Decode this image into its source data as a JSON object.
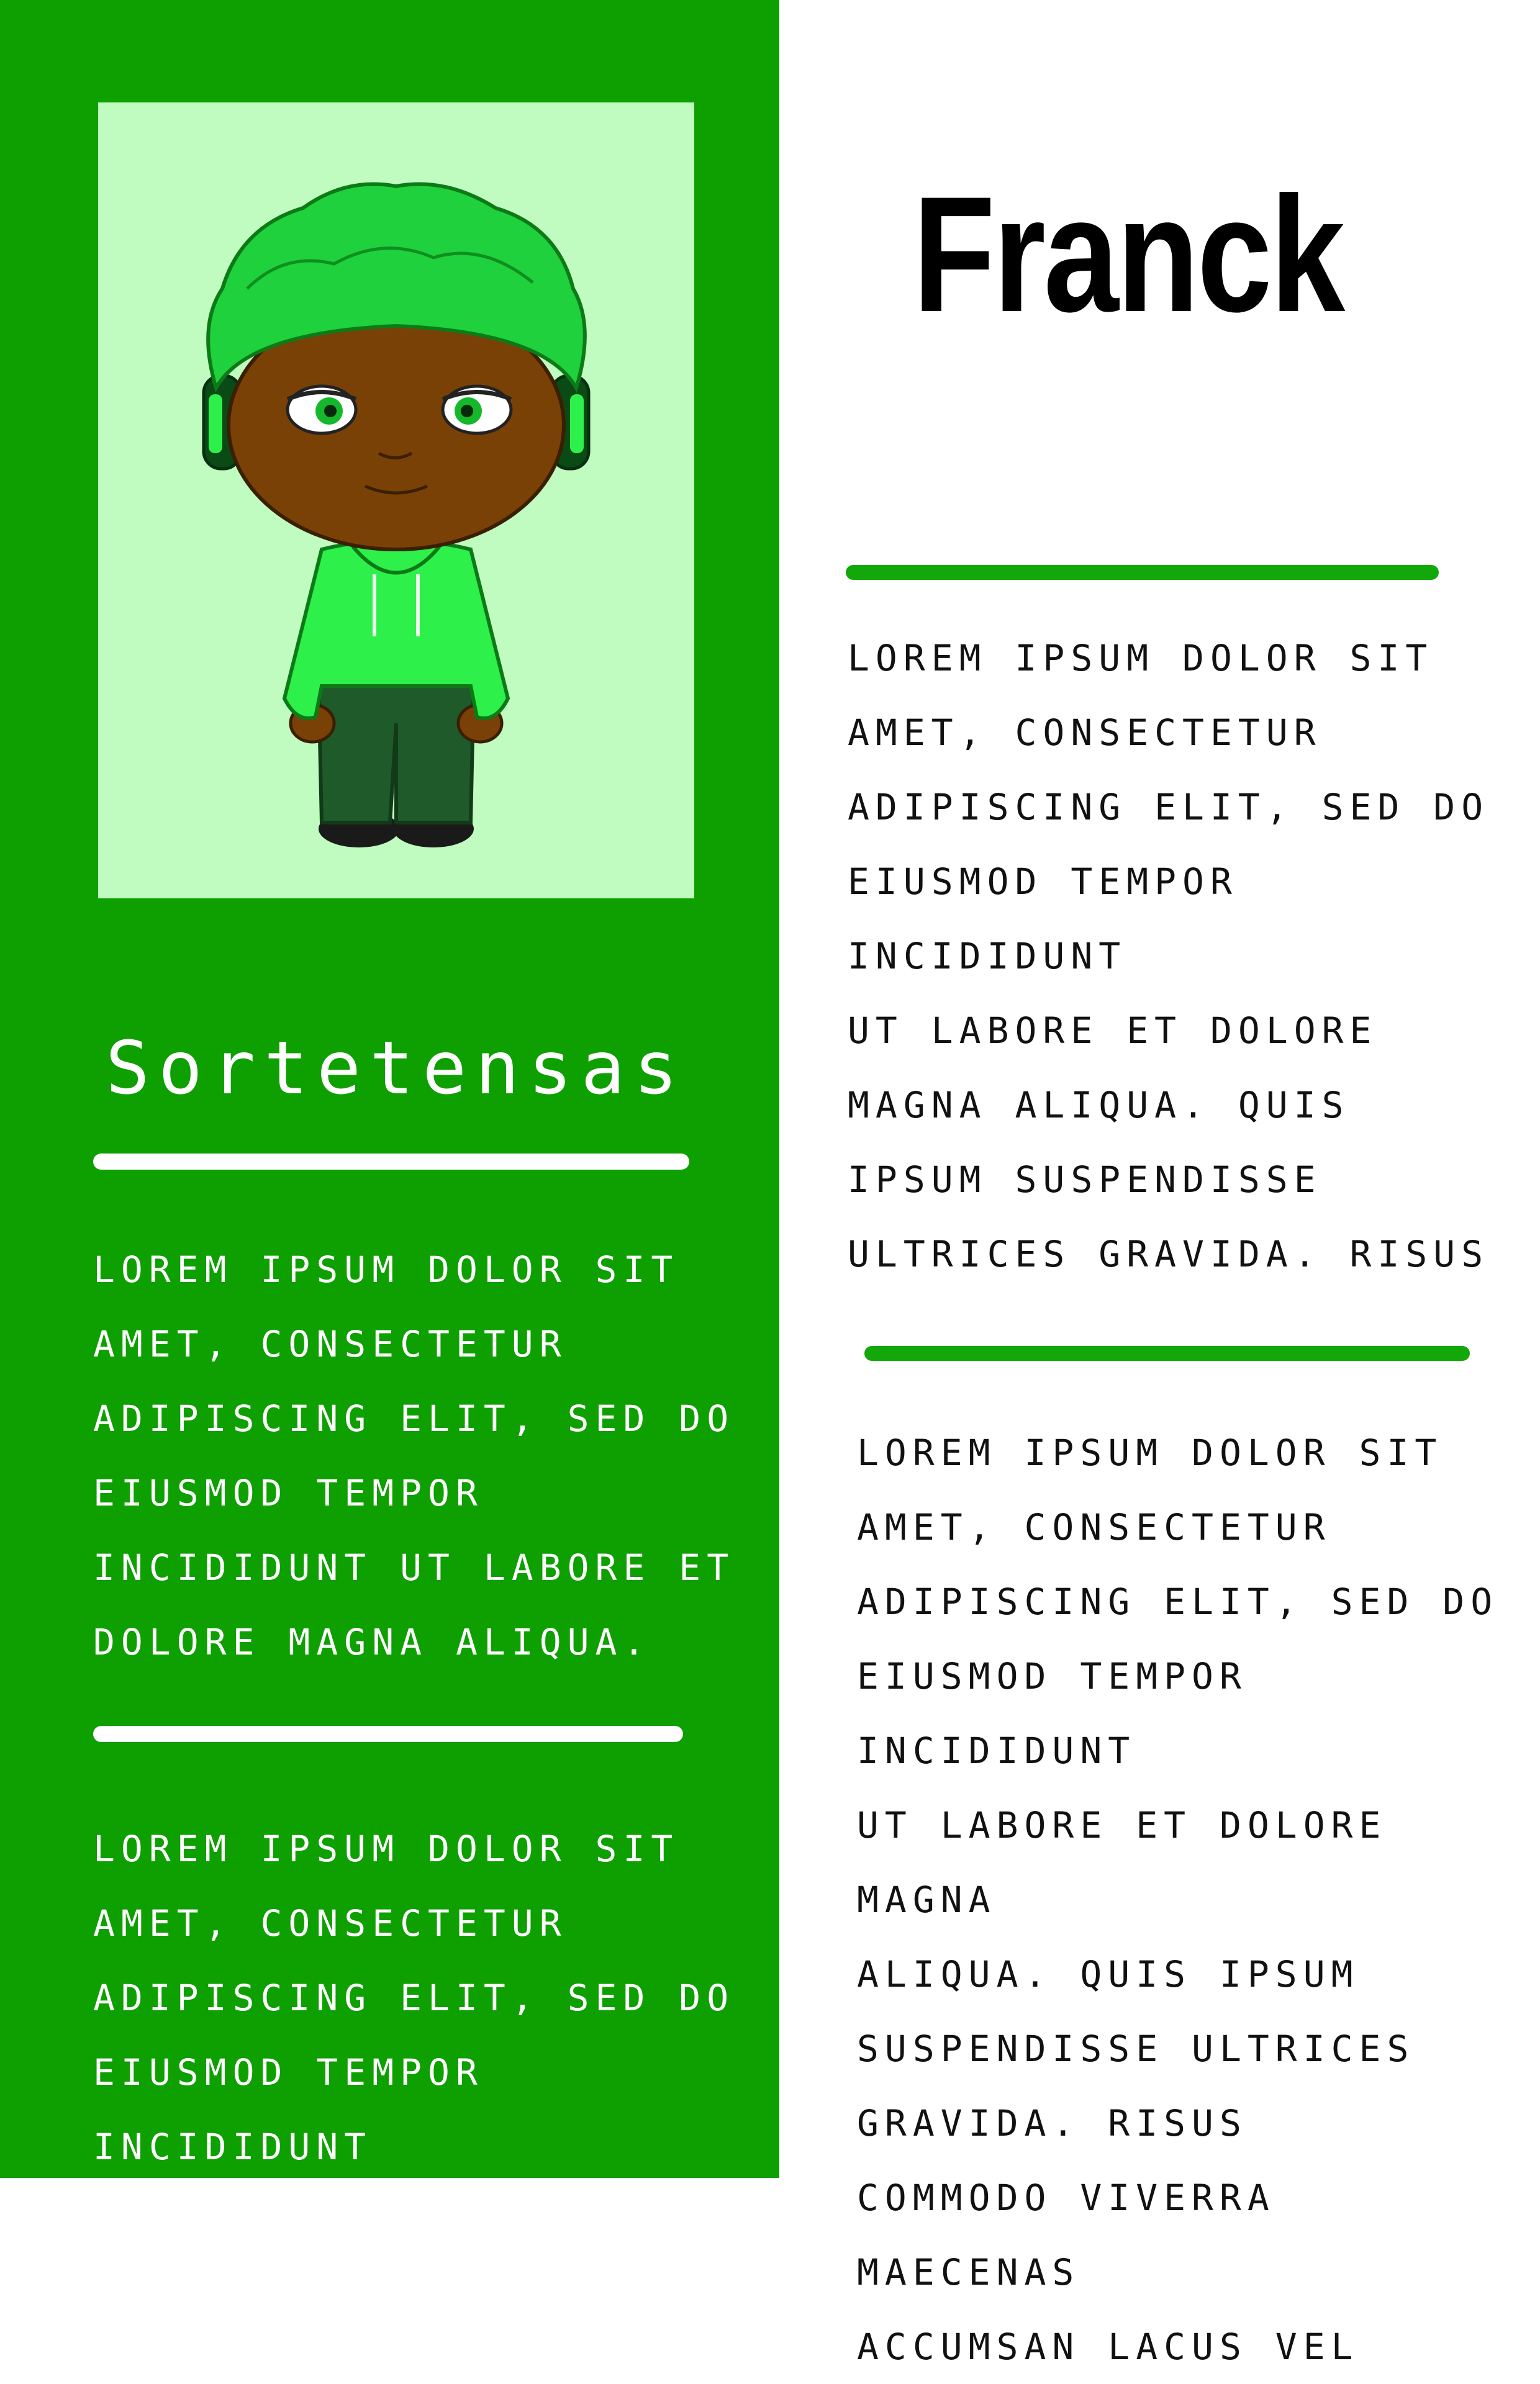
{
  "profile": {
    "name": "Franck"
  },
  "sidebar": {
    "portrait_label": "avatar",
    "heading": "Sortetensas",
    "paragraph_1": "LOREM IPSUM DOLOR SIT\nAMET, CONSECTETUR\nADIPISCING ELIT, SED DO\nEIUSMOD TEMPOR\nINCIDIDUNT UT LABORE ET\nDOLORE MAGNA ALIQUA.",
    "paragraph_2": "LOREM IPSUM DOLOR SIT\nAMET, CONSECTETUR\nADIPISCING ELIT, SED DO\nEIUSMOD TEMPOR INCIDIDUNT"
  },
  "main": {
    "paragraph_1": "LOREM IPSUM DOLOR SIT\nAMET, CONSECTETUR\nADIPISCING ELIT, SED DO\nEIUSMOD TEMPOR INCIDIDUNT\nUT LABORE ET DOLORE\nMAGNA ALIQUA. QUIS\nIPSUM SUSPENDISSE\nULTRICES GRAVIDA. RISUS",
    "paragraph_2": "LOREM IPSUM DOLOR SIT\nAMET, CONSECTETUR\nADIPISCING ELIT, SED DO\nEIUSMOD TEMPOR INCIDIDUNT\nUT LABORE ET DOLORE MAGNA\nALIQUA. QUIS IPSUM\nSUSPENDISSE ULTRICES\nGRAVIDA. RISUS\n COMMODO VIVERRA MAECENAS\nACCUMSAN LACUS VEL"
  },
  "colors": {
    "sidebar_bg": "#0e9f00",
    "portrait_bg": "#c0fbbf",
    "accent_green": "#13a80a",
    "hair_green": "#1fd13c",
    "hoodie_green": "#2ef04a",
    "skin": "#7a4106"
  }
}
